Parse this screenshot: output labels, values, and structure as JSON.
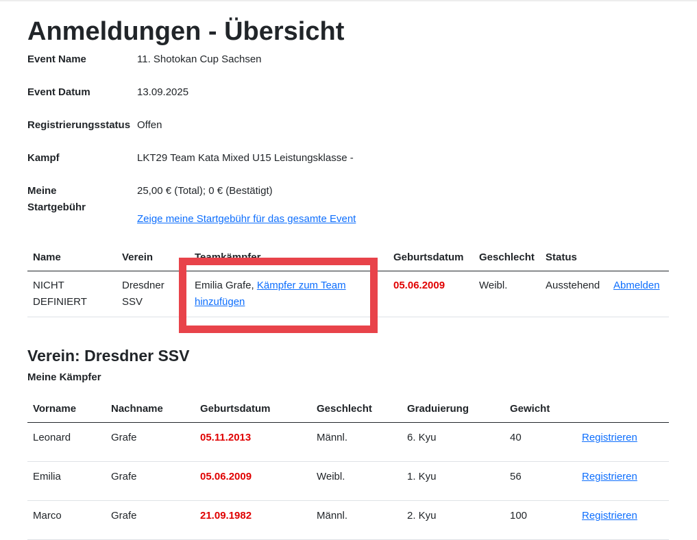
{
  "page": {
    "title": "Anmeldungen - Übersicht"
  },
  "details": {
    "event_name_label": "Event Name",
    "event_name": "11. Shotokan Cup Sachsen",
    "event_date_label": "Event Datum",
    "event_date": "13.09.2025",
    "reg_status_label": "Registrierungsstatus",
    "reg_status": "Offen",
    "kampf_label": "Kampf",
    "kampf": "LKT29 Team Kata Mixed U15 Leistungsklasse -",
    "fee_label_1": "Meine",
    "fee_label_2": "Startgebühr",
    "fee": "25,00 € (Total); 0 € (Bestätigt)",
    "fee_link": "Zeige meine Startgebühr für das gesamte Event"
  },
  "registration_table": {
    "headers": [
      "Name",
      "Verein",
      "Teamkämpfer",
      "Geburtsdatum",
      "Geschlecht",
      "Status"
    ],
    "row": {
      "name_1": "NICHT",
      "name_2": "DEFINIERT",
      "verein_1": "Dresdner",
      "verein_2": "SSV",
      "teammember": "Emilia Grafe, ",
      "add_link_1": "Kämpfer zum Team",
      "add_link_2": "hinzufügen",
      "birthdate": "05.06.2009",
      "gender": "Weibl.",
      "status": "Ausstehend",
      "unregister": "Abmelden"
    }
  },
  "club": {
    "heading": "Verein: Dresdner SSV",
    "subtitle": "Meine Kämpfer"
  },
  "fighters_table": {
    "headers": [
      "Vorname",
      "Nachname",
      "Geburtsdatum",
      "Geschlecht",
      "Graduierung",
      "Gewicht"
    ],
    "rows": [
      {
        "first": "Leonard",
        "last": "Grafe",
        "birthdate": "05.11.2013",
        "gender": "Männl.",
        "grade": "6. Kyu",
        "weight": "40",
        "action": "Registrieren"
      },
      {
        "first": "Emilia",
        "last": "Grafe",
        "birthdate": "05.06.2009",
        "gender": "Weibl.",
        "grade": "1. Kyu",
        "weight": "56",
        "action": "Registrieren"
      },
      {
        "first": "Marco",
        "last": "Grafe",
        "birthdate": "21.09.1982",
        "gender": "Männl.",
        "grade": "2. Kyu",
        "weight": "100",
        "action": "Registrieren"
      }
    ]
  },
  "colors": {
    "link": "#0d6efd",
    "date_red": "#e00000",
    "highlight": "#e8434a"
  }
}
